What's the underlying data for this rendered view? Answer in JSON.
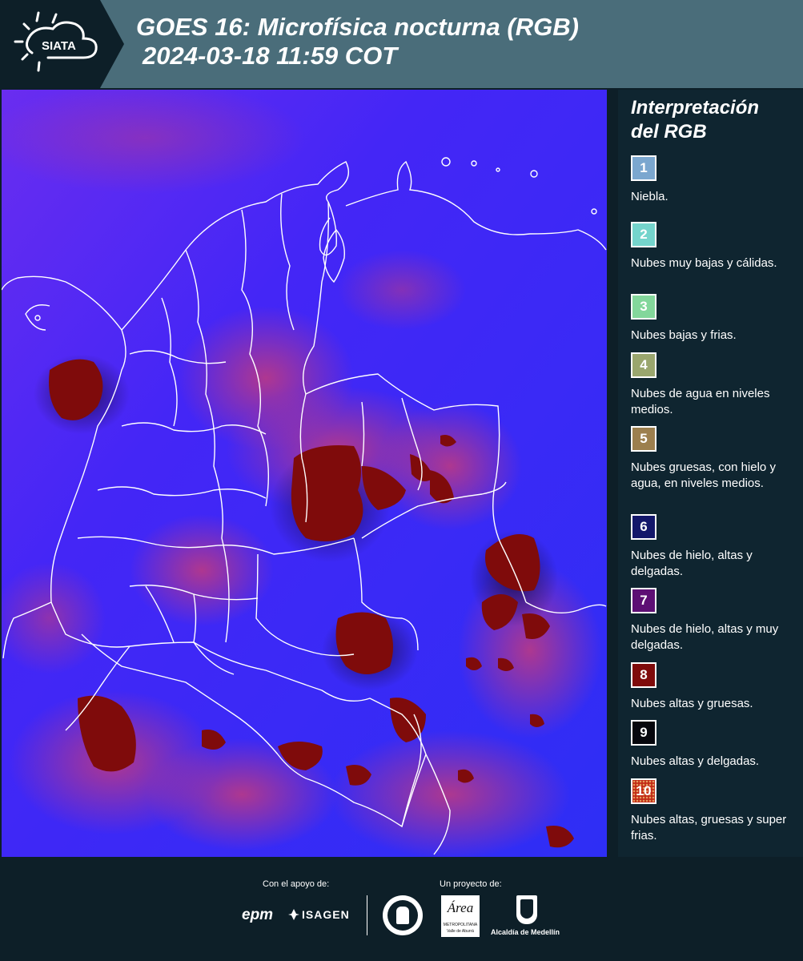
{
  "header": {
    "logo_text": "SIATA",
    "title_line1": "GOES 16: Microfísica nocturna (RGB)",
    "title_line2": "2024-03-18 11:59 COT"
  },
  "legend": {
    "title": "Interpretación del RGB",
    "items": [
      {
        "num": "1",
        "label": "Niebla.",
        "color": "#7ba7cf"
      },
      {
        "num": "2",
        "label": "Nubes muy bajas y cálidas.",
        "color": "#74d4cc"
      },
      {
        "num": "3",
        "label": "Nubes bajas y frias.",
        "color": "#83d79b"
      },
      {
        "num": "4",
        "label": "Nubes de agua en niveles medios.",
        "color": "#9aa66e"
      },
      {
        "num": "5",
        "label": "Nubes gruesas, con hielo y agua, en niveles medios.",
        "color": "#9c7f4e"
      },
      {
        "num": "6",
        "label": "Nubes de hielo, altas y delgadas.",
        "color": "#13176a"
      },
      {
        "num": "7",
        "label": "Nubes de hielo, altas y muy delgadas.",
        "color": "#5d0f74"
      },
      {
        "num": "8",
        "label": "Nubes altas y gruesas.",
        "color": "#7f0b0b"
      },
      {
        "num": "9",
        "label": "Nubes altas y delgadas.",
        "color": "#06070d"
      },
      {
        "num": "10",
        "label": "Nubes altas, gruesas y super frias.",
        "color": "#c22a16"
      }
    ]
  },
  "footer": {
    "support_label": "Con el apoyo de:",
    "project_label": "Un proyecto de:",
    "sponsor1": "epm",
    "sponsor2": "ISAGEN",
    "org1_line1": "Área",
    "org1_line2": "METROPOLITANA",
    "org1_line3": "Valle de Aburrá",
    "org2": "Alcaldía de Medellín"
  },
  "colors": {
    "header_bg": "#4a6d7a",
    "page_bg": "#0d1f28",
    "map_base": "#3b22f5",
    "cloud_dark_red": "#7f0b0b",
    "cloud_pink": "#b5387a"
  }
}
